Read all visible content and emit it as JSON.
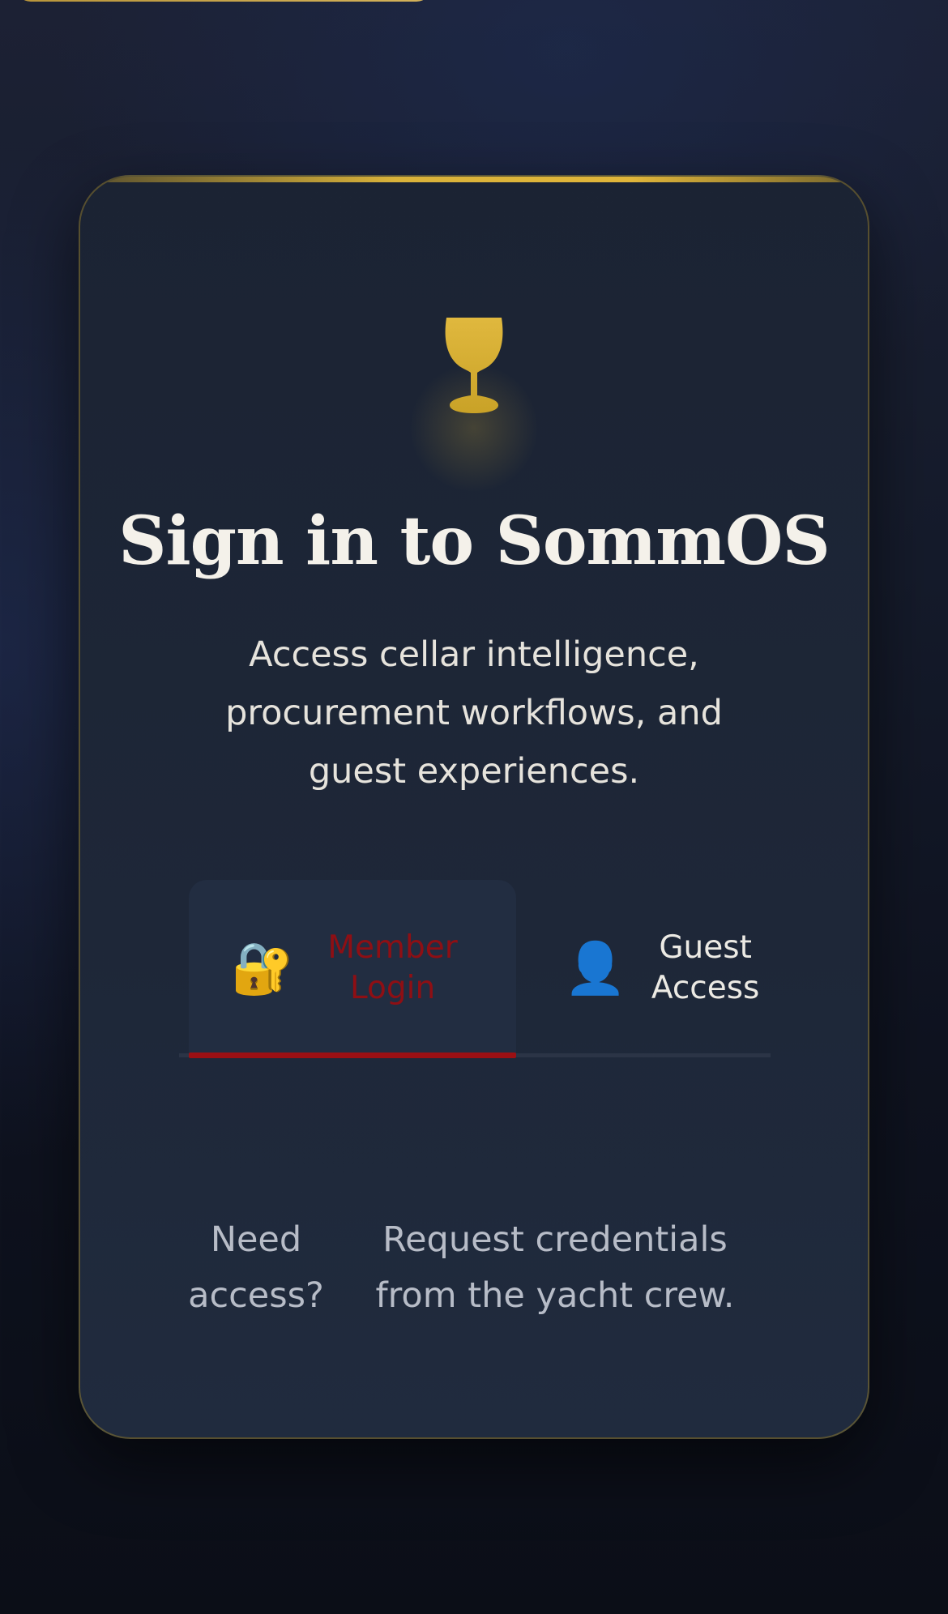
{
  "colors": {
    "accent_gold": "#d4af37",
    "active_tab_red": "#9b1014",
    "card_background": "#1e2738",
    "page_background": "#0f1320"
  },
  "logo": {
    "icon": "wine-glass-icon"
  },
  "header": {
    "title": "Sign in to SommOS",
    "subtitle": "Access cellar intelligence, procurement workflows, and guest experiences."
  },
  "tabs": [
    {
      "label": "Member Login",
      "icon": "lock-with-key-icon",
      "icon_glyph": "🔐",
      "active": true
    },
    {
      "label": "Guest Access",
      "icon": "user-silhouette-icon",
      "icon_glyph": "👤",
      "active": false
    }
  ],
  "help": {
    "label": "Need access?",
    "text": "Request credentials from the yacht crew."
  }
}
